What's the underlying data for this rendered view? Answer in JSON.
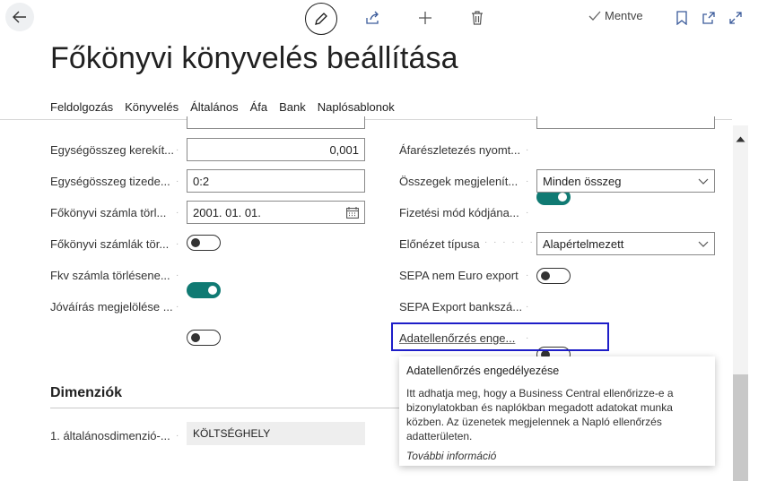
{
  "toolbar": {
    "saved_label": "Mentve"
  },
  "page": {
    "title": "Főkönyvi könyvelés beállítása"
  },
  "tabs": [
    "Feldolgozás",
    "Könyvelés",
    "Általános",
    "Áfa",
    "Bank",
    "Naplósablonok"
  ],
  "left_fields": [
    {
      "label": "Egységösszeg kerekít...",
      "type": "input",
      "value": "0,001"
    },
    {
      "label": "Egységösszeg tizede...",
      "type": "input",
      "value": "0:2"
    },
    {
      "label": "Főkönyvi számla törl...",
      "type": "date",
      "value": "2001. 01. 01."
    },
    {
      "label": "Főkönyvi számlák tör...",
      "type": "toggle",
      "on": false
    },
    {
      "label": "Fkv számla törlésene...",
      "type": "toggle",
      "on": true
    },
    {
      "label": "Jóváírás megjelölése ...",
      "type": "toggle",
      "on": false
    }
  ],
  "right_fields": [
    {
      "label": "Áfarészletezés nyomt...",
      "type": "toggle",
      "on": true
    },
    {
      "label": "Összegek megjelenít...",
      "type": "select",
      "value": "Minden összeg"
    },
    {
      "label": "Fizetési mód kódjána...",
      "type": "toggle",
      "on": false
    },
    {
      "label": "Előnézet típusa",
      "type": "select",
      "value": "Alapértelmezett"
    },
    {
      "label": "SEPA nem Euro export",
      "type": "toggle",
      "on": false
    },
    {
      "label": "SEPA Export bankszá...",
      "type": "toggle",
      "on": false
    },
    {
      "label": "Adatellenőrzés enge...",
      "type": "toggle",
      "on": true
    }
  ],
  "dimensions": {
    "title": "Dimenziók",
    "field_label": "1. általánosdimenzió-...",
    "field_value": "KÖLTSÉGHELY"
  },
  "tooltip": {
    "title": "Adatellenőrzés engedélyezése",
    "body": "Itt adhatja meg, hogy a Business Central ellenőrizze-e a bizonylatokban és naplókban megadott adatokat munka közben. Az üzenetek megjelennek a Napló ellenőrzés adatterületen.",
    "more": "További információ"
  },
  "colors": {
    "accent_toggle": "#107a73",
    "highlight_border": "#1e1ec8"
  }
}
